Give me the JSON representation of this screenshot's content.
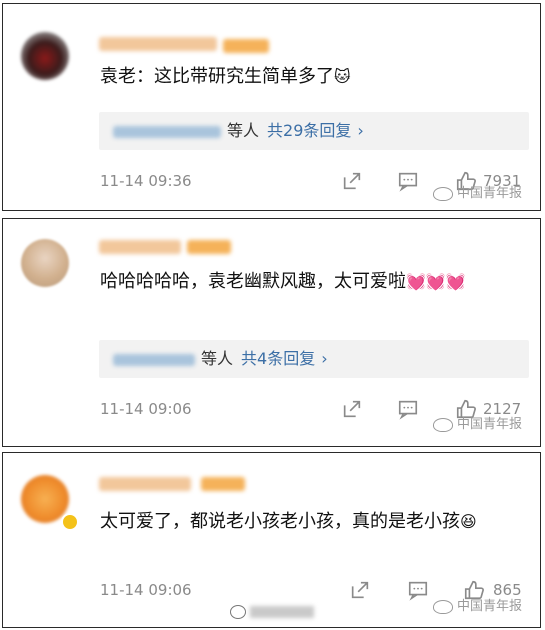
{
  "comments": [
    {
      "text": "袁老：这比带研究生简单多了",
      "emoji": "🐱",
      "reply_suffix": "等人",
      "reply_count": "共29条回复",
      "time": "11-14 09:36",
      "likes": "7931"
    },
    {
      "text": "哈哈哈哈哈，袁老幽默风趣，太可爱啦",
      "emoji": "💓💓💓",
      "reply_suffix": "等人",
      "reply_count": "共4条回复",
      "time": "11-14 09:06",
      "likes": "2127"
    },
    {
      "text": "太可爱了，都说老小孩老小孩，真的是老小孩",
      "emoji": "😆",
      "time": "11-14 09:06",
      "likes": "865"
    }
  ],
  "ui": {
    "reply_chevron": "›"
  },
  "watermark": {
    "label": "中国青年报"
  },
  "icons": [
    "share-icon",
    "comment-icon",
    "like-icon",
    "weibo-logo-icon"
  ]
}
